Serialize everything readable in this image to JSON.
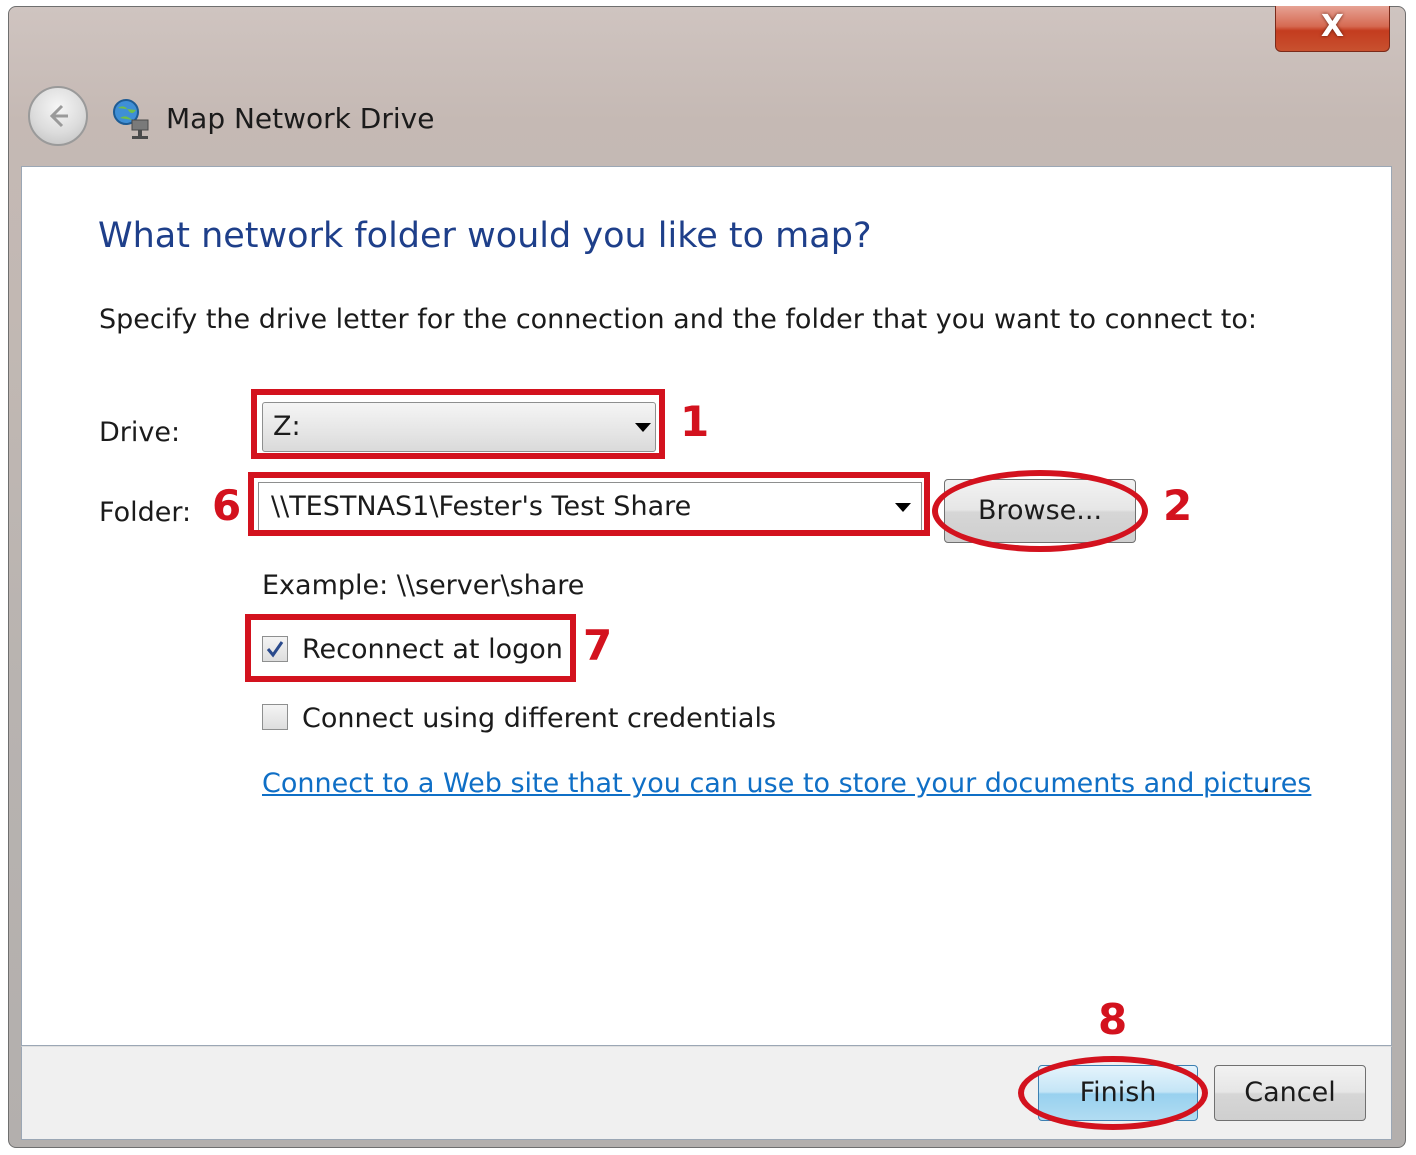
{
  "window": {
    "title": "Map Network Drive",
    "close_glyph": "X"
  },
  "page": {
    "heading": "What network folder would you like to map?",
    "instruction": "Specify the drive letter for the connection and the folder that you want to connect to:"
  },
  "form": {
    "drive_label": "Drive:",
    "drive_value": "Z:",
    "folder_label": "Folder:",
    "folder_value": "\\\\TESTNAS1\\Fester's Test Share",
    "browse_label": "Browse...",
    "example_text": "Example: \\\\server\\share",
    "reconnect_label": "Reconnect at logon",
    "reconnect_checked": true,
    "credentials_label": "Connect using different credentials",
    "credentials_checked": false,
    "web_link": "Connect to a Web site that you can use to store your documents and pictures",
    "web_link_suffix": "."
  },
  "footer": {
    "finish_label": "Finish",
    "cancel_label": "Cancel"
  },
  "annotations": {
    "drive_number": "1",
    "browse_number": "2",
    "folder_number": "6",
    "reconnect_number": "7",
    "finish_number": "8",
    "color": "#d3121e"
  },
  "icons": {
    "back": "back-arrow-icon",
    "app": "network-drive-icon",
    "dropdown": "dropdown-arrow-icon",
    "check": "checkmark-icon"
  },
  "colors": {
    "heading": "#1e3f8a",
    "link": "#0f6fc6",
    "close_button": "#c43c1f",
    "finish_button": "#98d1ef"
  }
}
